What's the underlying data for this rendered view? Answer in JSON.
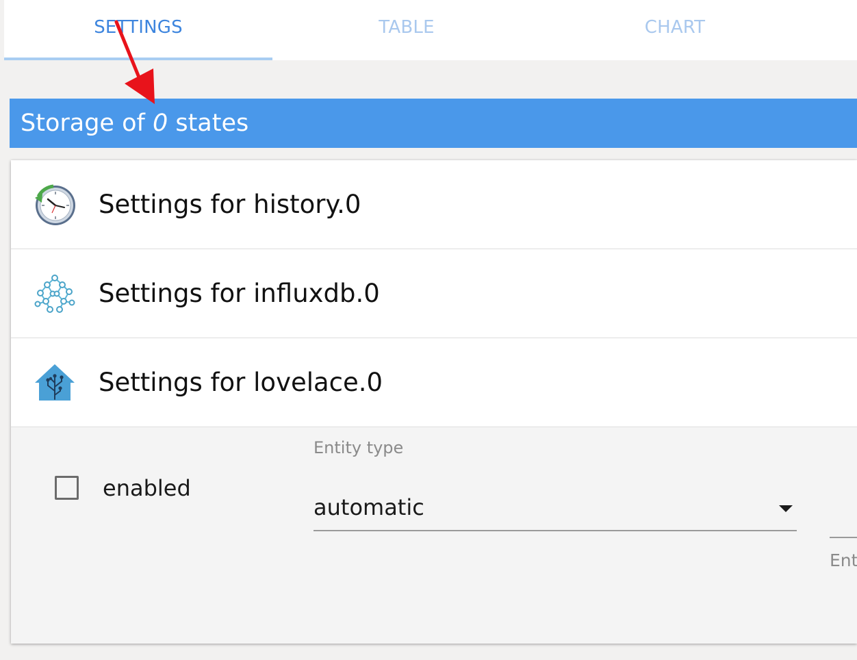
{
  "tabs": [
    {
      "label": "SETTINGS",
      "active": true
    },
    {
      "label": "TABLE",
      "active": false
    },
    {
      "label": "CHART",
      "active": false
    }
  ],
  "storage": {
    "prefix": "Storage of ",
    "count": "0",
    "suffix": " states"
  },
  "adapters": [
    {
      "label": "Settings for history.0",
      "icon": "history-clock-icon"
    },
    {
      "label": "Settings for influxdb.0",
      "icon": "influxdb-network-icon"
    },
    {
      "label": "Settings for lovelace.0",
      "icon": "lovelace-house-icon"
    }
  ],
  "detail": {
    "enabled_label": "enabled",
    "enabled_checked": false,
    "entity_type_label": "Entity type",
    "entity_type_value": "automatic",
    "second_field_label": "Enti"
  },
  "colors": {
    "accent": "#4a98ea",
    "tab_active": "#3d85de",
    "tab_inactive": "#a9c8ee",
    "annotation": "#e8131b"
  }
}
